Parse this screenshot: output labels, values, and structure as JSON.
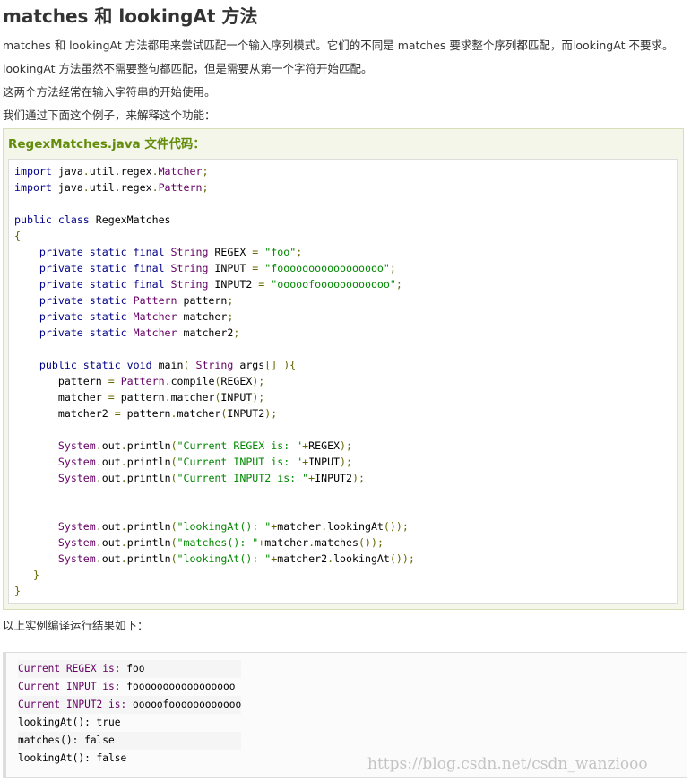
{
  "page": {
    "title": "matches 和 lookingAt 方法",
    "paragraphs": [
      "matches 和 lookingAt 方法都用来尝试匹配一个输入序列模式。它们的不同是 matches 要求整个序列都匹配，而lookingAt 不要求。",
      "lookingAt 方法虽然不需要整句都匹配，但是需要从第一个字符开始匹配。",
      "这两个方法经常在输入字符串的开始使用。",
      "我们通过下面这个例子，来解释这个功能："
    ],
    "result_intro": "以上实例编译运行结果如下："
  },
  "example": {
    "title": "RegexMatches.java 文件代码：",
    "code_lines": [
      "import java.util.regex.Matcher;",
      "import java.util.regex.Pattern;",
      "",
      "public class RegexMatches",
      "{",
      "    private static final String REGEX = \"foo\";",
      "    private static final String INPUT = \"fooooooooooooooooo\";",
      "    private static final String INPUT2 = \"ooooofoooooooooooo\";",
      "    private static Pattern pattern;",
      "    private static Matcher matcher;",
      "    private static Matcher matcher2;",
      "",
      "    public static void main( String args[] ){",
      "       pattern = Pattern.compile(REGEX);",
      "       matcher = pattern.matcher(INPUT);",
      "       matcher2 = pattern.matcher(INPUT2);",
      "",
      "       System.out.println(\"Current REGEX is: \"+REGEX);",
      "       System.out.println(\"Current INPUT is: \"+INPUT);",
      "       System.out.println(\"Current INPUT2 is: \"+INPUT2);",
      "",
      "",
      "       System.out.println(\"lookingAt(): \"+matcher.lookingAt());",
      "       System.out.println(\"matches(): \"+matcher.matches());",
      "       System.out.println(\"lookingAt(): \"+matcher2.lookingAt());",
      "   }",
      "}"
    ]
  },
  "output": {
    "lines": [
      "Current REGEX is: foo",
      "Current INPUT is: fooooooooooooooooo",
      "Current INPUT2 is: ooooofoooooooooooo",
      "lookingAt(): true",
      "matches(): false",
      "lookingAt(): false"
    ]
  },
  "watermark": "https://blog.csdn.net/csdn_wanziooo",
  "colors": {
    "title_green": "#638c0b",
    "example_bg": "#f3f6e9",
    "code_keyword": "#000088",
    "code_type": "#660066",
    "code_string": "#008800",
    "code_punct": "#666600"
  }
}
